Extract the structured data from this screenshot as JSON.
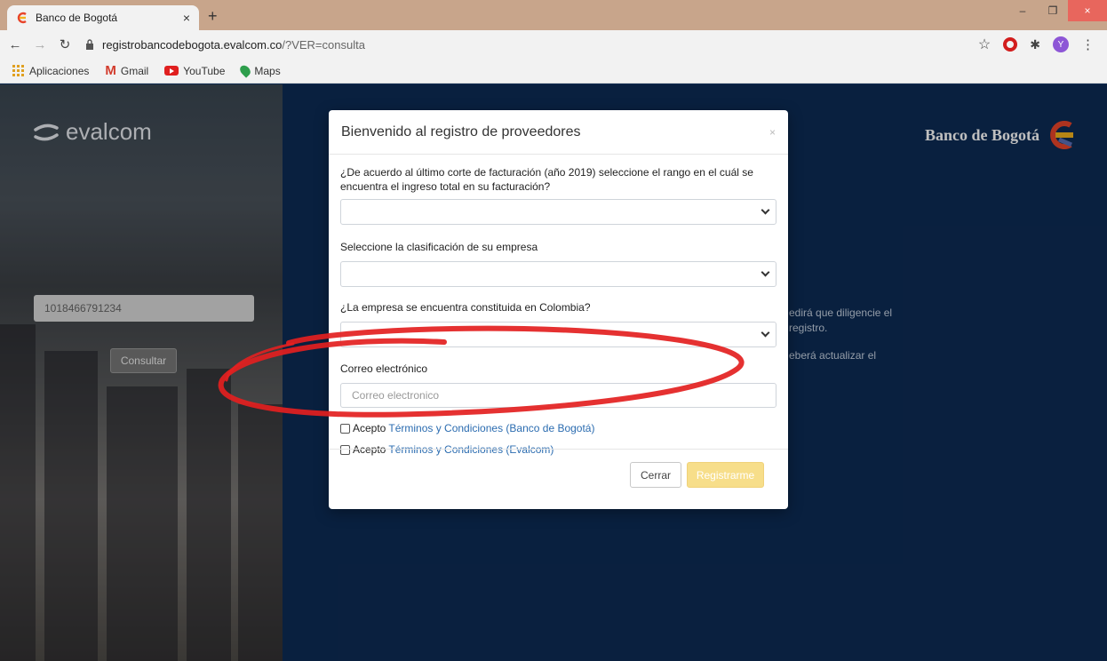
{
  "browser": {
    "tab_title": "Banco de Bogotá",
    "tab_close": "×",
    "new_tab": "+",
    "url_domain": "registrobancodebogota.evalcom.co",
    "url_path": "/?VER=consulta",
    "avatar_letter": "Y",
    "window_min": "–",
    "window_max": "❐",
    "window_close": "×",
    "bookmarks": [
      {
        "label": "Aplicaciones"
      },
      {
        "label": "Gmail"
      },
      {
        "label": "YouTube"
      },
      {
        "label": "Maps"
      }
    ]
  },
  "page": {
    "brand": "evalcom",
    "bank_name": "Banco de Bogotá",
    "id_value": "1018466791234",
    "consult_button": "Consultar",
    "bg_fragments": [
      "edirá que diligencie el",
      "registro.",
      "eberá actualizar el"
    ]
  },
  "modal": {
    "title": "Bienvenido al registro de proveedores",
    "close": "×",
    "q1_label": "¿De acuerdo al último corte de facturación (año 2019) seleccione el rango en el cuál se encuentra el ingreso total en su facturación?",
    "q2_label": "Seleccione la clasificación de su empresa",
    "q3_label": "¿La empresa se encuentra constituida en Colombia?",
    "email_label": "Correo electrónico",
    "email_placeholder": "Correo electronico",
    "terms1_prefix": "Acepto",
    "terms1_link": "Términos y Condiciones (Banco de Bogotá)",
    "terms2_prefix": "Acepto",
    "terms2_link": "Términos y Condiciones (Evalcom)",
    "close_button": "Cerrar",
    "register_button": "Registrarme"
  },
  "colors": {
    "page_bg": "#0d2b54",
    "annotation": "#e32020",
    "register_button": "#f7de8a",
    "link": "#2b6cb0"
  }
}
